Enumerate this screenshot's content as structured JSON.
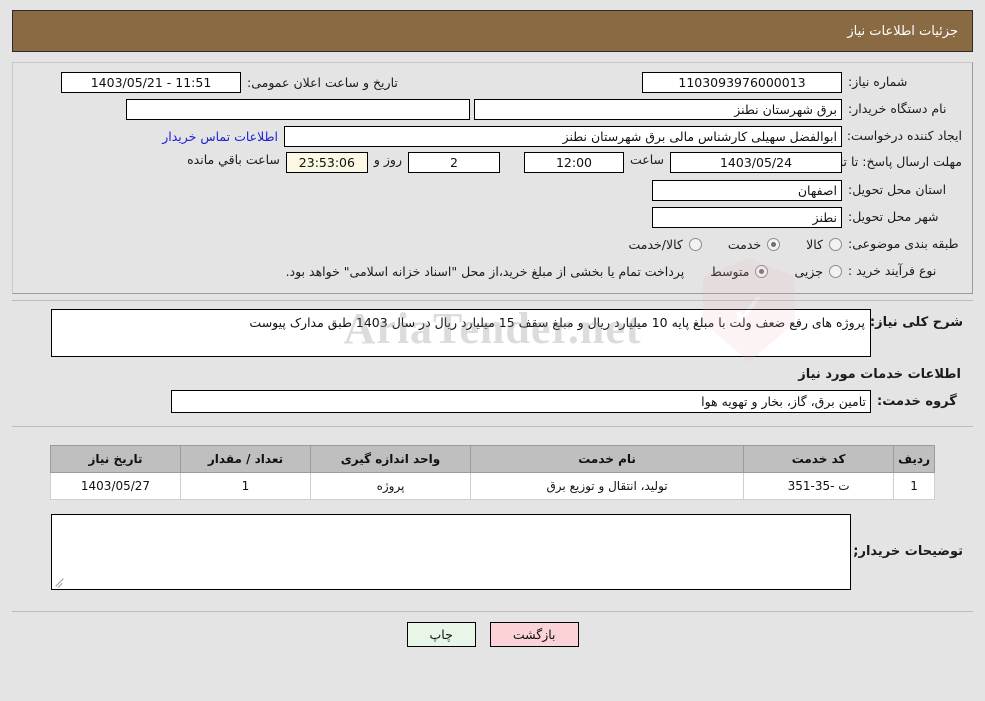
{
  "header": {
    "title": "جزئیات اطلاعات نیاز"
  },
  "watermark": {
    "text": "AriaTender.net",
    "shield_icon": "shield-check-icon"
  },
  "top_form": {
    "need_number": {
      "label": "شماره نیاز:",
      "value": "1103093976000013"
    },
    "public_announce": {
      "label": "تاریخ و ساعت اعلان عمومی:",
      "value": "11:51 - 1403/05/21"
    },
    "buyer_org": {
      "label": "نام دستگاه خریدار:",
      "value": "برق شهرستان نطنز"
    },
    "buyer_org_extra": {
      "value": ""
    },
    "creator": {
      "label": "ایجاد کننده درخواست:",
      "value": "ابوالفضل سهیلی کارشناس مالی برق شهرستان نطنز"
    },
    "contact_link": {
      "label": "اطلاعات تماس خریدار"
    },
    "deadline": {
      "label": "مهلت ارسال پاسخ: تا تاریخ:",
      "date": "1403/05/24",
      "time_label": "ساعت",
      "time": "12:00",
      "days": "2",
      "days_label": "روز و",
      "countdown": "23:53:06",
      "countdown_label": "ساعت باقي مانده"
    },
    "province": {
      "label": "استان محل تحویل:",
      "value": "اصفهان"
    },
    "city": {
      "label": "شهر محل تحویل:",
      "value": "نطنز"
    },
    "category": {
      "label": "طبقه بندی موضوعی:",
      "options": [
        {
          "label": "کالا",
          "checked": false
        },
        {
          "label": "خدمت",
          "checked": true
        },
        {
          "label": "کالا/خدمت",
          "checked": false
        }
      ]
    },
    "process_type": {
      "label": "نوع فرآیند خرید :",
      "options": [
        {
          "label": "جزیی",
          "checked": false
        },
        {
          "label": "متوسط",
          "checked": true
        }
      ],
      "note": "پرداخت تمام یا بخشی از مبلغ خرید،از محل \"اسناد خزانه اسلامی\" خواهد بود."
    }
  },
  "description": {
    "label": "شرح کلی نیاز:",
    "value": "پروژه های رفع ضعف ولت با مبلغ پایه 10 میلیارد ریال و مبلغ سقف 15 میلیارد ریال در سال 1403 طبق مدارک پیوست"
  },
  "services_section": {
    "title": "اطلاعات خدمات مورد نیاز",
    "service_group": {
      "label": "گروه خدمت:",
      "value": "تامین برق، گاز، بخار و تهویه هوا"
    },
    "table": {
      "columns": [
        "ردیف",
        "کد خدمت",
        "نام خدمت",
        "واحد اندازه گیری",
        "تعداد / مقدار",
        "تاریخ نیاز"
      ],
      "rows": [
        {
          "index": "1",
          "code": "ت -35-351",
          "name": "تولید، انتقال و توزیع برق",
          "unit": "پروژه",
          "quantity": "1",
          "need_date": "1403/05/27"
        }
      ]
    }
  },
  "buyer_notes": {
    "label": "توضیحات خریدار;",
    "value": ""
  },
  "footer": {
    "print_label": "چاپ",
    "back_label": "بازگشت"
  },
  "colors": {
    "header_bg": "#8a6a43",
    "page_bg": "#e4e4e4",
    "link": "#1b21d6",
    "table_header_bg": "#bfbfbf",
    "print_btn_bg": "#e8f6e8",
    "back_btn_bg": "#fbd3d6",
    "countdown_bg": "#fbf8e3"
  }
}
